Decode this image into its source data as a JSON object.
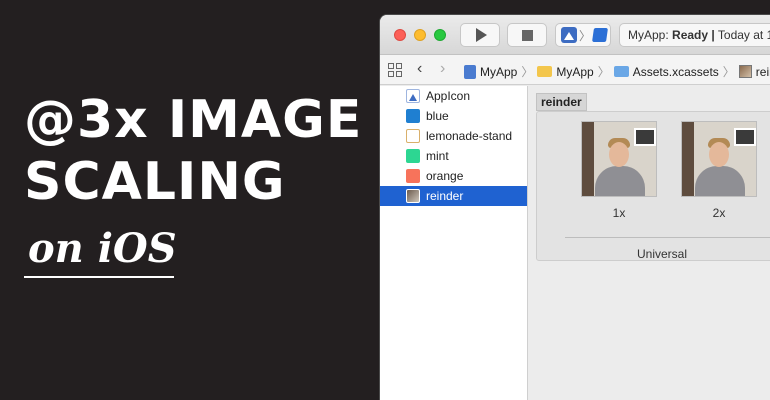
{
  "headline": {
    "line1": "@3x IMAGE",
    "line2": "SCALING",
    "sub": "on iOS"
  },
  "toolbar": {
    "status_app": "MyApp:",
    "status_state": "Ready",
    "status_sep": "|",
    "status_time": "Today at 1"
  },
  "breadcrumbs": [
    {
      "label": "MyApp",
      "icon": "xcode-project-icon"
    },
    {
      "label": "MyApp",
      "icon": "yellow-folder-icon"
    },
    {
      "label": "Assets.xcassets",
      "icon": "blue-folder-icon"
    },
    {
      "label": "reind",
      "icon": "image-set-icon"
    }
  ],
  "navigator": {
    "items": [
      {
        "label": "AppIcon",
        "swatch": "appicon"
      },
      {
        "label": "blue",
        "swatch": "#1f7fd1"
      },
      {
        "label": "lemonade-stand",
        "swatch": "lemon"
      },
      {
        "label": "mint",
        "swatch": "#2dd692"
      },
      {
        "label": "orange",
        "swatch": "#f7735b"
      },
      {
        "label": "reinder",
        "swatch": "photo",
        "selected": true
      }
    ]
  },
  "editor": {
    "set_name": "reinder",
    "slots": [
      {
        "label": "1x"
      },
      {
        "label": "2x"
      }
    ],
    "group_label": "Universal"
  },
  "colors": {
    "background": "#231f20",
    "selection": "#1f62d1"
  }
}
